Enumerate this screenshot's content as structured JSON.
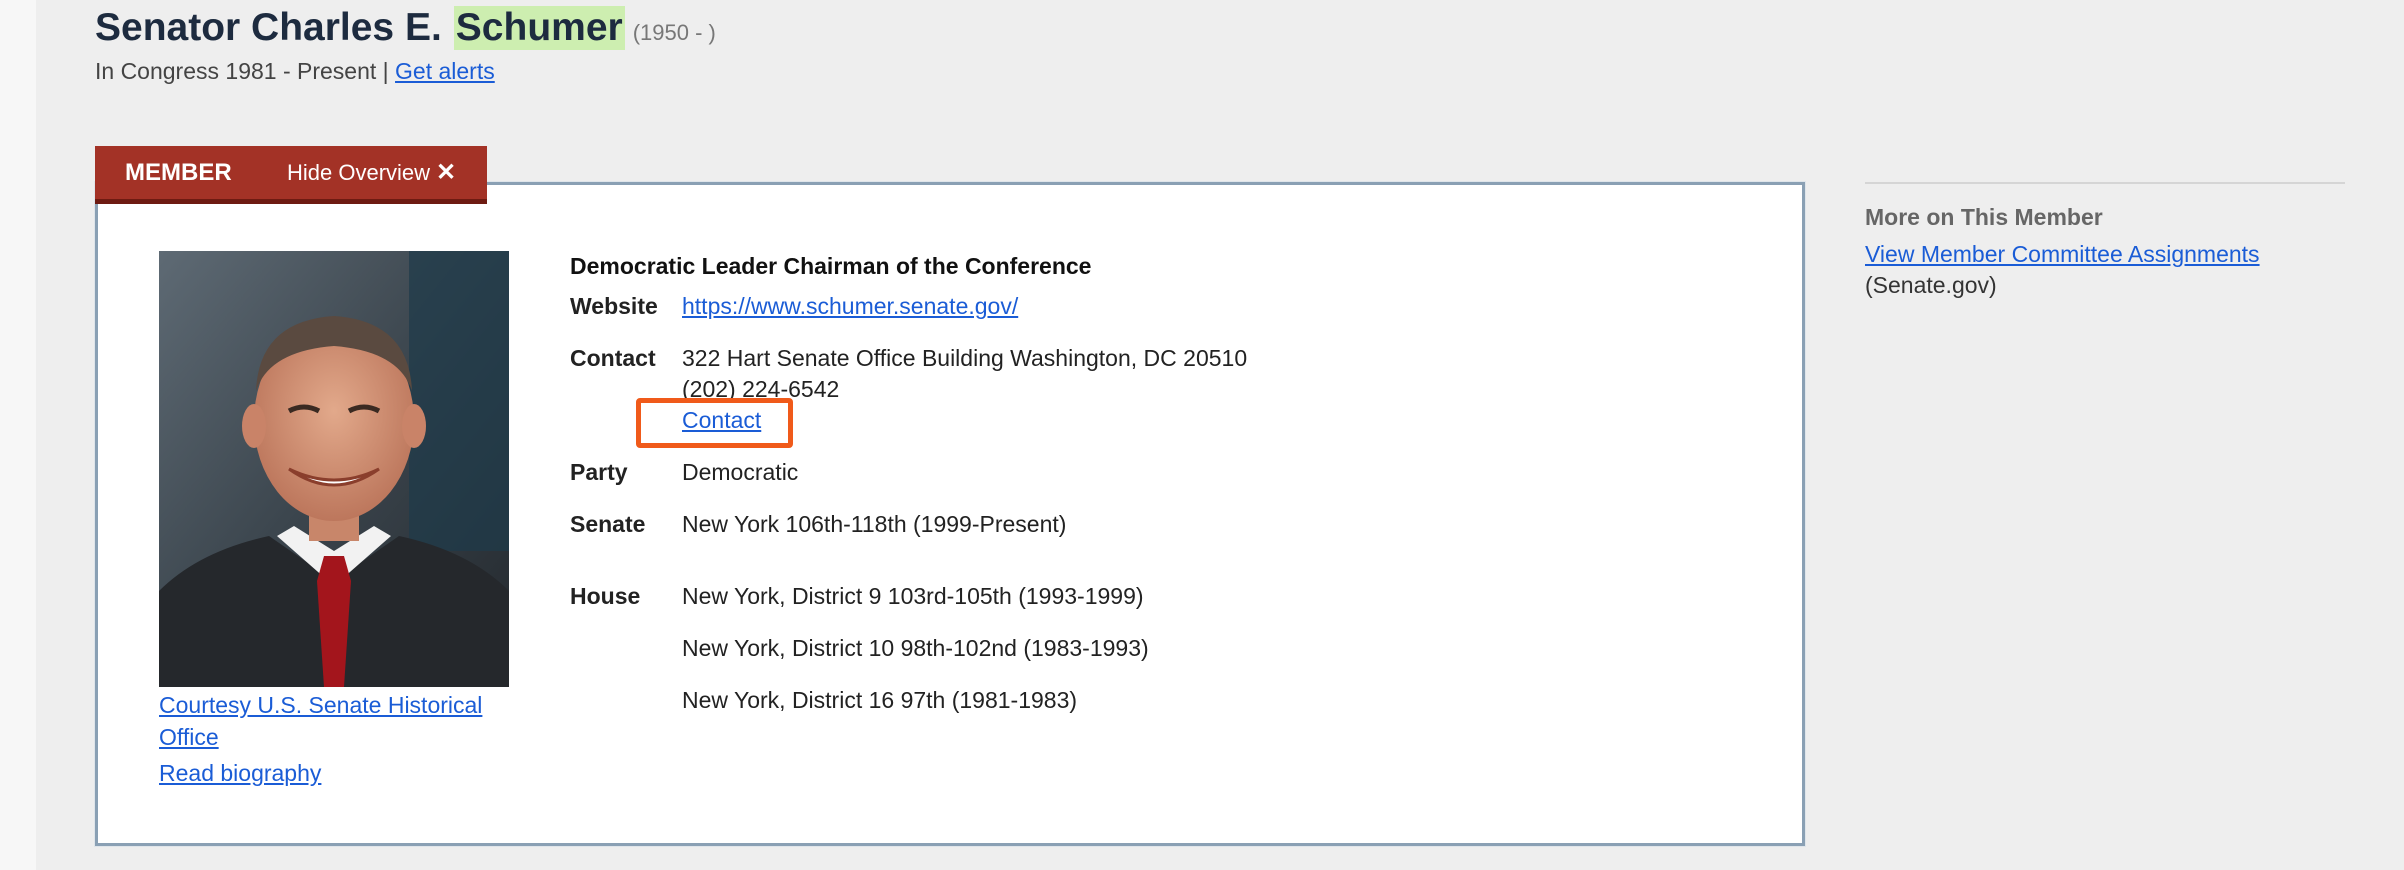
{
  "header": {
    "title_prefix": "Senator Charles E.",
    "title_highlight": "Schumer",
    "lifespan": "(1950 - )",
    "congress_text": "In Congress 1981 - Present |",
    "alerts_link": "Get alerts"
  },
  "tabs": {
    "member_label": "MEMBER",
    "hide_label": "Hide Overview",
    "close_glyph": "✕"
  },
  "profile": {
    "photo_caption": "Courtesy U.S. Senate Historical Office",
    "read_biography": "Read biography",
    "role_title": "Democratic Leader Chairman of the Conference",
    "website_label": "Website",
    "website_url": "https://www.schumer.senate.gov/",
    "contact_label": "Contact",
    "contact_address": "322 Hart Senate Office Building Washington, DC 20510",
    "contact_phone": "(202) 224-6542",
    "contact_link": "Contact",
    "party_label": "Party",
    "party_value": "Democratic",
    "senate_label": "Senate",
    "senate_value": "New York 106th-118th (1999-Present)",
    "house_label": "House",
    "house_terms": [
      "New York, District 9 103rd-105th (1993-1999)",
      "New York, District 10 98th-102nd (1983-1993)",
      "New York, District 16 97th (1981-1983)"
    ]
  },
  "sidebar": {
    "title": "More on This Member",
    "committee_link": "View Member Committee Assignments",
    "committee_note": "(Senate.gov)"
  },
  "colors": {
    "tab_background": "#a33226",
    "highlight": "#cdeeb0",
    "link": "#1a5cd6",
    "focus_box": "#f05a1a"
  }
}
